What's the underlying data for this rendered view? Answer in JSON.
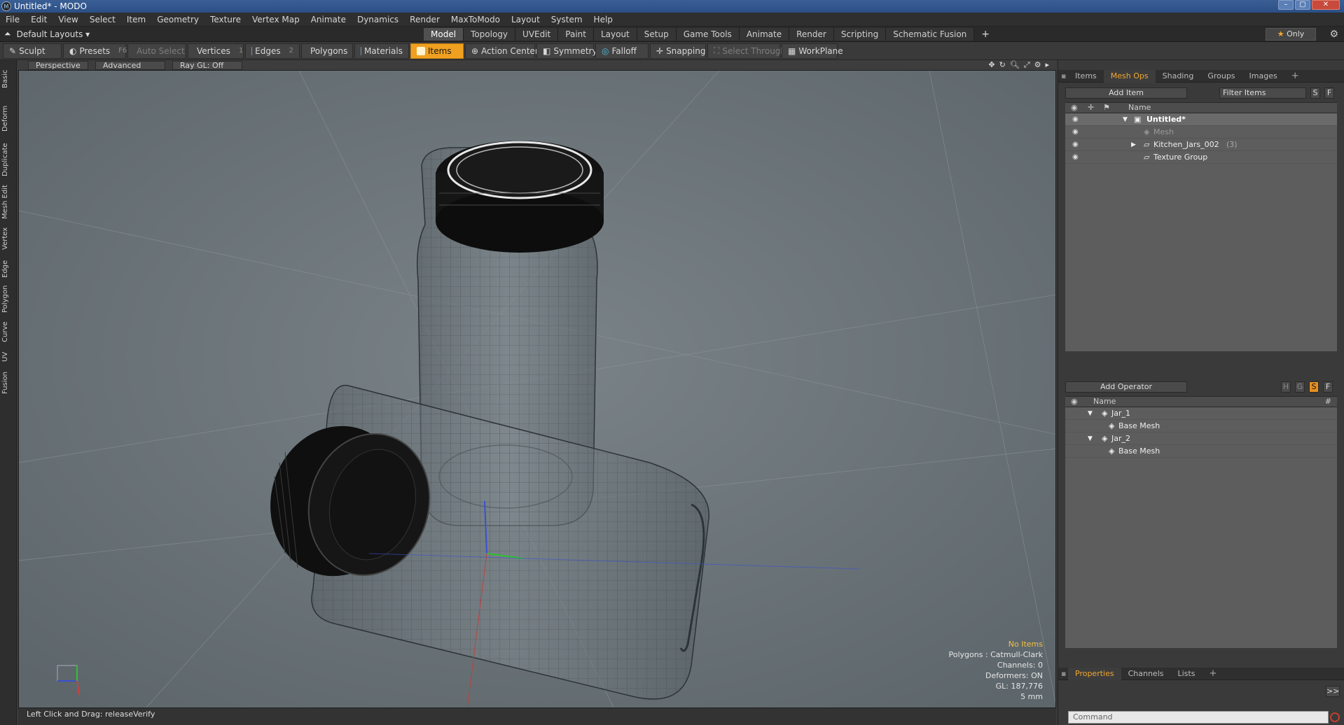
{
  "window": {
    "title": "Untitled* - MODO",
    "app_icon": "modo-icon",
    "min": "–",
    "max": "▢",
    "close": "✕"
  },
  "menu": [
    "File",
    "Edit",
    "View",
    "Select",
    "Item",
    "Geometry",
    "Texture",
    "Vertex Map",
    "Animate",
    "Dynamics",
    "Render",
    "MaxToModo",
    "Layout",
    "System",
    "Help"
  ],
  "layout": {
    "label": "Default Layouts ▾"
  },
  "tabs": [
    "Model",
    "Topology",
    "UVEdit",
    "Paint",
    "Layout",
    "Setup",
    "Game Tools",
    "Animate",
    "Render",
    "Scripting",
    "Schematic Fusion"
  ],
  "tabs_plus": "+",
  "only": {
    "star": "★",
    "label": "Only"
  },
  "toolbar": {
    "sculpt": "Sculpt",
    "presets": "Presets",
    "presets_key": "F6",
    "auto_select": "Auto Select",
    "vertices": "Vertices",
    "vertices_key": "1",
    "edges": "Edges",
    "edges_key": "2",
    "polygons": "Polygons",
    "materials": "Materials",
    "items": "Items",
    "action_center": "Action Center",
    "symmetry": "Symmetry",
    "falloff": "Falloff",
    "snapping": "Snapping",
    "select_through": "Select Through",
    "workplane": "WorkPlane"
  },
  "left_tabs": [
    "Basic",
    "Deform",
    "Duplicate",
    "Mesh Edit",
    "Vertex",
    "Edge",
    "Polygon",
    "Curve",
    "UV",
    "Fusion"
  ],
  "viewport": {
    "view": "Perspective",
    "advanced": "Advanced",
    "raygl": "Ray GL: Off",
    "info": {
      "items": "No Items",
      "polygons": "Polygons : Catmull-Clark",
      "channels": "Channels: 0",
      "deformers": "Deformers: ON",
      "gl": "GL: 187,776",
      "unit": "5 mm"
    }
  },
  "status": {
    "text": "Left Click and Drag:   releaseVerify"
  },
  "items_panel": {
    "tabs": [
      "Items",
      "Mesh Ops",
      "Shading",
      "Groups",
      "Images"
    ],
    "plus": "+",
    "add_item": "Add Item",
    "filter": "Filter Items",
    "s": "S",
    "f": "F",
    "col_name": "Name",
    "rows": [
      {
        "name": "Untitled*",
        "bold": true,
        "arrow": "▼"
      },
      {
        "name": "Mesh",
        "dim": true,
        "arrow": ""
      },
      {
        "name": "Kitchen_Jars_002",
        "count": "(3)",
        "arrow": "▶"
      },
      {
        "name": "Texture Group",
        "arrow": ""
      }
    ]
  },
  "meshops_panel": {
    "add_operator": "Add Operator",
    "h": "H",
    "g": "G",
    "s": "S",
    "f": "F",
    "col_name": "Name",
    "col_hash": "#",
    "rows": [
      {
        "name": "Jar_1",
        "arrow": "▼",
        "child": false
      },
      {
        "name": "Base Mesh",
        "arrow": "",
        "child": true
      },
      {
        "name": "Jar_2",
        "arrow": "▼",
        "child": false
      },
      {
        "name": "Base Mesh",
        "arrow": "",
        "child": true
      }
    ]
  },
  "props_panel": {
    "tabs": [
      "Properties",
      "Channels",
      "Lists"
    ],
    "plus": "+",
    "expand": ">>",
    "command_placeholder": "Command"
  }
}
